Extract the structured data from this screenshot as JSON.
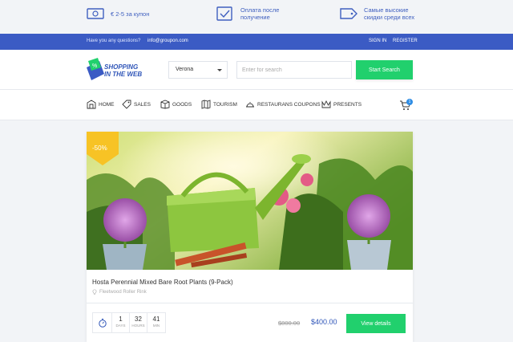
{
  "promo": [
    {
      "icon": "money-icon",
      "text_line1": "€ 2-5 за купон",
      "text_line2": ""
    },
    {
      "icon": "checkbox-icon",
      "text_line1": "Оплата после",
      "text_line2": "получение"
    },
    {
      "icon": "tag-icon",
      "text_line1": "Самые высокие",
      "text_line2": "скидки среди всех"
    }
  ],
  "topbar": {
    "question": "Have you any questions?",
    "email": "info@groupon.com",
    "signin": "SIGN IN",
    "register": "REGISTER"
  },
  "header": {
    "logo_line1": "SHOPPING",
    "logo_line2": "IN THE WEB",
    "logo_badge": "%",
    "city": "Verona",
    "search_placeholder": "Enter for search",
    "search_button": "Start Search"
  },
  "nav": [
    {
      "label": "HOME",
      "icon": "home-icon"
    },
    {
      "label": "SALES",
      "icon": "tag-icon"
    },
    {
      "label": "GOODS",
      "icon": "box-icon"
    },
    {
      "label": "TOURISM",
      "icon": "map-icon"
    },
    {
      "label": "RESTAURANS COUPONS",
      "icon": "cloche-icon"
    },
    {
      "label": "PRESENTS",
      "icon": "crown-icon"
    }
  ],
  "cart": {
    "count": "1"
  },
  "deal": {
    "discount": "-50%",
    "title": "Hosta Perennial Mixed Bare Root Plants (9-Pack)",
    "location": "Fleetwood Roller Rink",
    "timer": [
      {
        "value": "1",
        "label": "DAYS"
      },
      {
        "value": "32",
        "label": "HOURS"
      },
      {
        "value": "41",
        "label": "MIN"
      }
    ],
    "old_price": "$800.00",
    "new_price": "$400.00",
    "button": "View details"
  },
  "colors": {
    "accent_blue": "#3b5bc4",
    "accent_green": "#21d06d",
    "discount": "#f7c325"
  }
}
